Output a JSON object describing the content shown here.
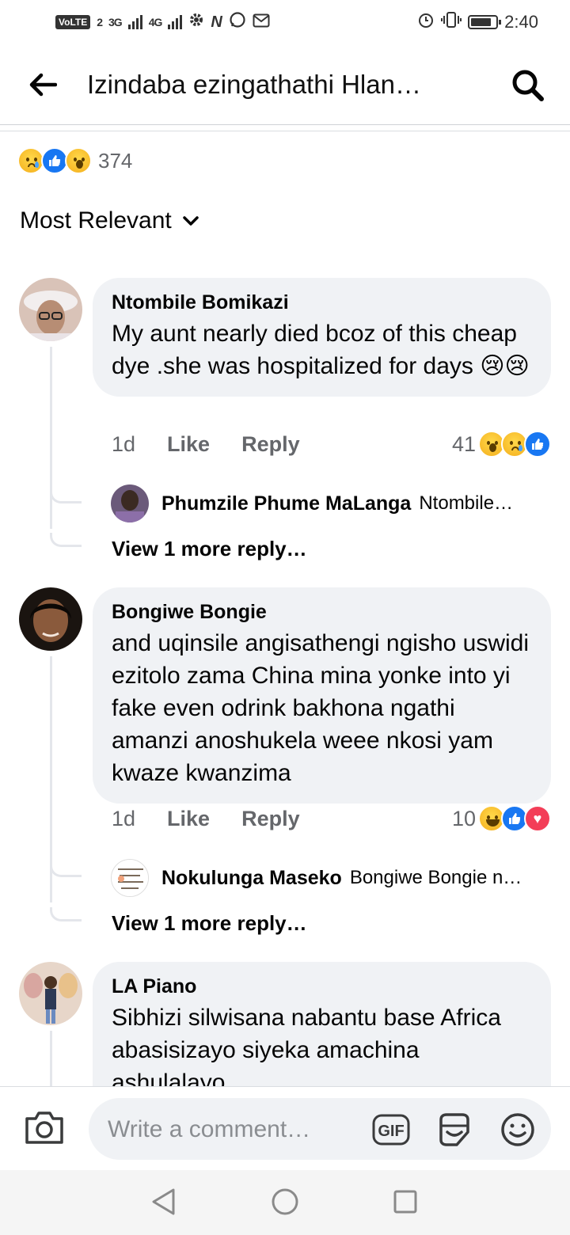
{
  "status_bar": {
    "volte": "VoLTE",
    "sim_slot": "2",
    "net1": "3G",
    "net2": "4G",
    "time": "2:40",
    "battery_level": 0.82
  },
  "header": {
    "title": "Izindaba ezingathathi Hlan…",
    "back_icon": "back-arrow-icon",
    "search_icon": "search-icon"
  },
  "reactions_summary": {
    "icons": [
      "sad",
      "like",
      "wow"
    ],
    "count": "374"
  },
  "sort": {
    "label": "Most Relevant",
    "icon": "chevron-down-icon"
  },
  "comments": [
    {
      "author": "Ntombile Bomikazi",
      "text": "My aunt nearly died bcoz of this cheap dye .she was hospitalized for days 😢😢",
      "time": "1d",
      "like_label": "Like",
      "reply_label": "Reply",
      "reaction_count": "41",
      "reactions": [
        "wow",
        "sad",
        "like"
      ],
      "reply_preview": {
        "name": "Phumzile Phume MaLanga",
        "snippet": "Ntombile…"
      },
      "view_more": "View 1 more reply…"
    },
    {
      "author": "Bongiwe Bongie",
      "text": "and uqinsile angisathengi ngisho uswidi ezitolo zama China mina yonke into yi fake even odrink bakhona ngathi amanzi anoshukela weee nkosi yam kwaze kwanzima",
      "time": "1d",
      "like_label": "Like",
      "reply_label": "Reply",
      "reaction_count": "10",
      "reactions": [
        "haha",
        "like",
        "love"
      ],
      "reply_preview": {
        "name": "Nokulunga Maseko",
        "snippet": "Bongiwe Bongie n…"
      },
      "view_more": "View 1 more reply…"
    },
    {
      "author": "LA Piano",
      "text": "Sibhizi silwisana nabantu base Africa abasisizayo siyeka amachina ashulalayo"
    }
  ],
  "composer": {
    "placeholder": "Write a comment…",
    "gif_label": "GIF",
    "icons": [
      "camera-icon",
      "gif-icon",
      "sticker-icon",
      "emoji-icon"
    ]
  },
  "colors": {
    "bubble": "#f0f2f5",
    "meta_gray": "#65676b",
    "like_blue": "#1877f2",
    "love_red": "#f33e58",
    "emoji_yellow": "#f7b928"
  }
}
